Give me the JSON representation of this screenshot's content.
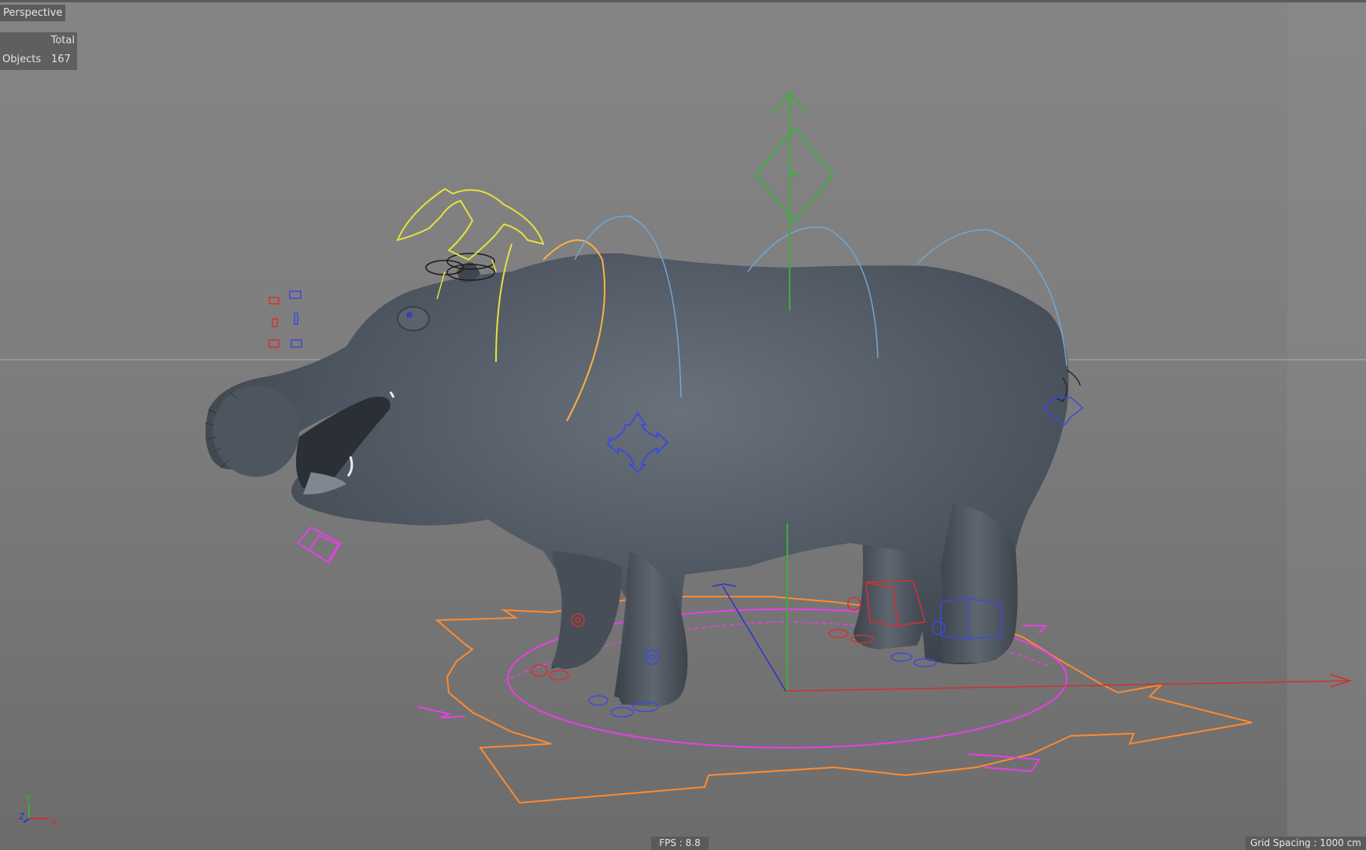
{
  "viewport": {
    "view_name": "Perspective",
    "hud": {
      "header": "Total",
      "objects_label": "Objects",
      "objects_count": "167"
    },
    "fps_text": "FPS : 8.8",
    "grid_spacing_text": "Grid Spacing : 1000 cm"
  },
  "axis_gizmo": {
    "x": "X",
    "y": "Y",
    "z": "Z"
  },
  "colors": {
    "viewport_bg": "#7d7d7d",
    "mesh": "#4d5560",
    "ik_controls": "#ff8a30",
    "ground_controls": "#e640e6",
    "spine_arcs": "#6ea8d8",
    "ear_controls": "#e6e040",
    "neck_arc": "#ffb040",
    "global_y_axis": "#3ab03a",
    "x_axis": "#d03030",
    "z_axis": "#3030d0",
    "hud_bg": "#5f5f5f",
    "hud_text": "#e2e2e2"
  }
}
